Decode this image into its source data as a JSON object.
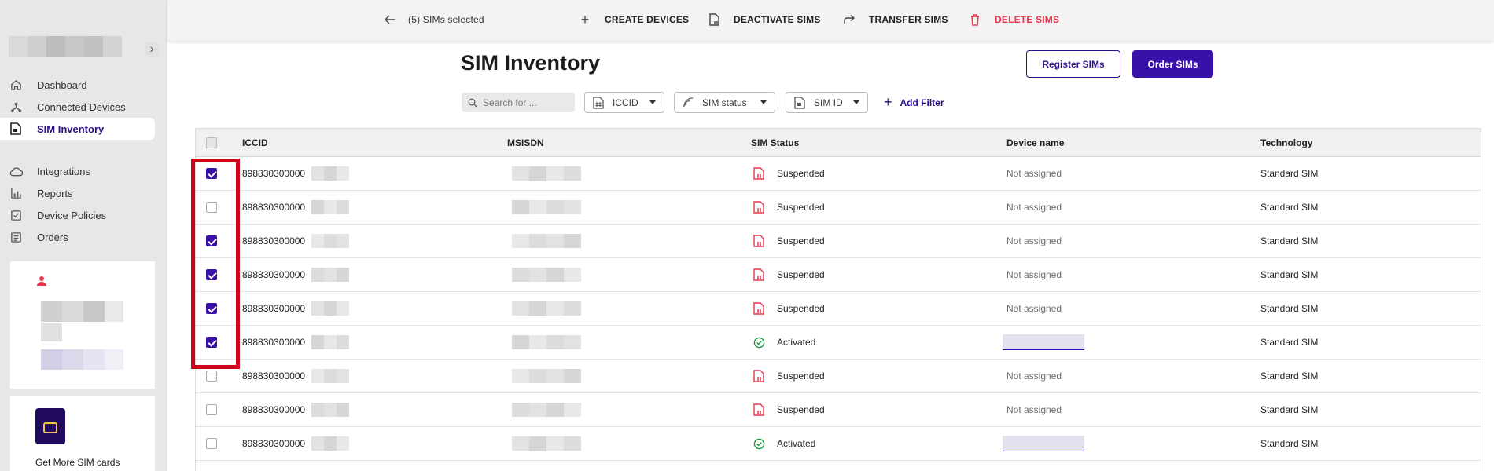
{
  "topbar": {
    "back_icon": "arrow-left-icon",
    "selected_label": "(5) SIMs selected",
    "actions": [
      {
        "label": "CREATE DEVICES",
        "icon": "plus-icon"
      },
      {
        "label": "DEACTIVATE SIMS",
        "icon": "sim-deactivate-icon"
      },
      {
        "label": "TRANSFER SIMS",
        "icon": "forward-arrow-icon"
      },
      {
        "label": "DELETE SIMS",
        "icon": "trash-icon",
        "color": "#e8344a"
      }
    ]
  },
  "sidebar": {
    "items": [
      {
        "label": "Dashboard",
        "icon": "home-icon"
      },
      {
        "label": "Connected Devices",
        "icon": "network-icon"
      },
      {
        "label": "SIM Inventory",
        "icon": "sim-card-icon",
        "active": true
      },
      {
        "label": "Integrations",
        "icon": "cloud-icon"
      },
      {
        "label": "Reports",
        "icon": "chart-icon"
      },
      {
        "label": "Device Policies",
        "icon": "policy-icon"
      },
      {
        "label": "Orders",
        "icon": "orders-icon"
      }
    ],
    "promo_text": "Get More SIM cards"
  },
  "header": {
    "title": "SIM Inventory",
    "register_label": "Register SIMs",
    "order_label": "Order SIMs"
  },
  "filters": {
    "search_placeholder": "Search for ...",
    "chips": [
      {
        "label": "ICCID",
        "icon": "hash-sim-icon"
      },
      {
        "label": "SIM status",
        "icon": "signal-icon"
      },
      {
        "label": "SIM ID",
        "icon": "sim-id-icon"
      }
    ],
    "add_filter_label": "Add Filter"
  },
  "table": {
    "columns": [
      "ICCID",
      "MSISDN",
      "SIM Status",
      "Device name",
      "Technology"
    ],
    "rows": [
      {
        "checked": true,
        "iccid": "898830300000",
        "status": "Suspended",
        "device": "Not assigned",
        "technology": "Standard SIM"
      },
      {
        "checked": false,
        "iccid": "898830300000",
        "status": "Suspended",
        "device": "Not assigned",
        "technology": "Standard SIM"
      },
      {
        "checked": true,
        "iccid": "898830300000",
        "status": "Suspended",
        "device": "Not assigned",
        "technology": "Standard SIM"
      },
      {
        "checked": true,
        "iccid": "898830300000",
        "status": "Suspended",
        "device": "Not assigned",
        "technology": "Standard SIM"
      },
      {
        "checked": true,
        "iccid": "898830300000",
        "status": "Suspended",
        "device": "Not assigned",
        "technology": "Standard SIM"
      },
      {
        "checked": true,
        "iccid": "898830300000",
        "status": "Activated",
        "device": "",
        "technology": "Standard SIM"
      },
      {
        "checked": false,
        "iccid": "898830300000",
        "status": "Suspended",
        "device": "Not assigned",
        "technology": "Standard SIM"
      },
      {
        "checked": false,
        "iccid": "898830300000",
        "status": "Suspended",
        "device": "Not assigned",
        "technology": "Standard SIM"
      },
      {
        "checked": false,
        "iccid": "898830300000",
        "status": "Activated",
        "device": "",
        "technology": "Standard SIM"
      }
    ]
  },
  "colors": {
    "accent": "#3a11a8",
    "suspended": "#e8344a",
    "activated": "#1a9b3c",
    "highlight": "#d0021b"
  }
}
